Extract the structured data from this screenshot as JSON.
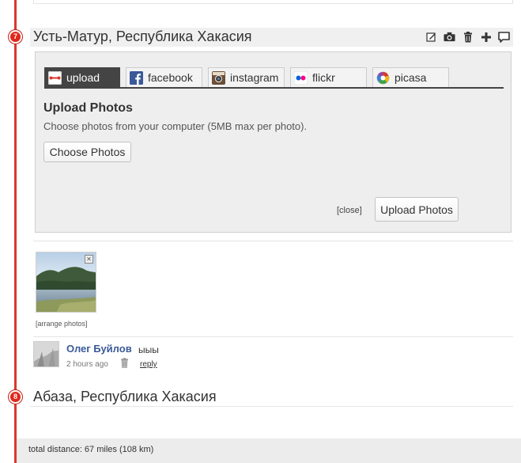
{
  "stops": [
    {
      "number": "7",
      "title": "Усть-Матур, Республика Хакасия",
      "actions": [
        "edit-icon",
        "camera-icon",
        "trash-icon",
        "plus-icon",
        "comment-icon"
      ]
    },
    {
      "number": "8",
      "title": "Абаза, Республика Хакасия"
    }
  ],
  "upload": {
    "tabs": [
      {
        "label": "upload",
        "icon": "upload-icon",
        "active": true
      },
      {
        "label": "facebook",
        "icon": "facebook-icon",
        "active": false
      },
      {
        "label": "instagram",
        "icon": "instagram-icon",
        "active": false
      },
      {
        "label": "flickr",
        "icon": "flickr-icon",
        "active": false
      },
      {
        "label": "picasa",
        "icon": "picasa-icon",
        "active": false
      }
    ],
    "heading": "Upload Photos",
    "description": "Choose photos from your computer (5MB max per photo).",
    "choose_button": "Choose Photos",
    "close_link": "[close]",
    "upload_button": "Upload Photos"
  },
  "photos": {
    "remove_glyph": "✕",
    "arrange_link": "[arrange photos]"
  },
  "comment": {
    "author": "Олег Буйлов",
    "text": "ыыы",
    "time": "2 hours ago",
    "reply_link": "reply"
  },
  "footer": {
    "total_distance": "total distance: 67 miles (108 km)"
  },
  "colors": {
    "timeline": "#d9382e",
    "marker": "#e1261c",
    "active_tab": "#444444",
    "author_link": "#3a5a98",
    "facebook": "#3b5998"
  }
}
